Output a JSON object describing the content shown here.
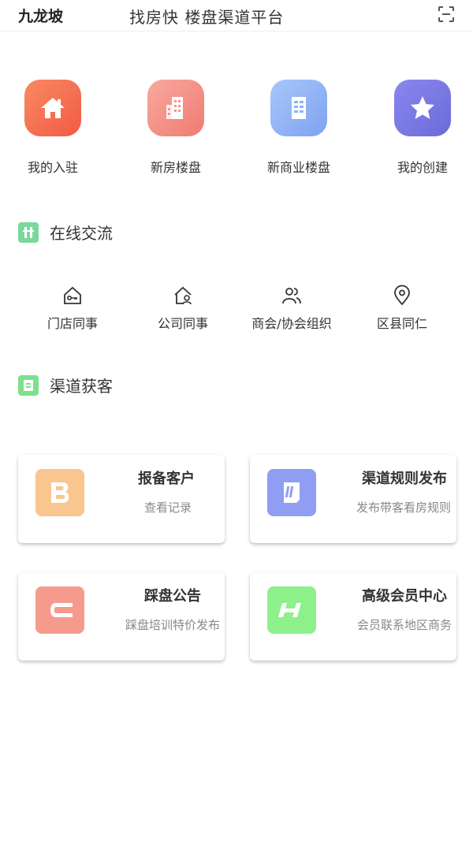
{
  "header": {
    "location": "九龙坡",
    "title": "找房快 楼盘渠道平台",
    "scan_icon": "scan-icon"
  },
  "quick_actions": [
    {
      "label": "我的入驻",
      "icon": "home-icon",
      "color": "#f76f52"
    },
    {
      "label": "新房楼盘",
      "icon": "building-icon",
      "color": "#f5968c"
    },
    {
      "label": "新商业楼盘",
      "icon": "office-icon",
      "color": "#8fb2f7"
    },
    {
      "label": "我的创建",
      "icon": "star-icon",
      "color": "#7b79e6"
    }
  ],
  "online": {
    "title": "在线交流",
    "icon_color": "#7bd89c",
    "items": [
      {
        "label": "门店同事",
        "icon": "store-key-icon"
      },
      {
        "label": "公司同事",
        "icon": "company-person-icon"
      },
      {
        "label": "商会/协会组织",
        "icon": "group-icon"
      },
      {
        "label": "区县同仁",
        "icon": "location-pin-icon"
      }
    ]
  },
  "channel": {
    "title": "渠道获客",
    "icon_color": "#7de08a",
    "cards": [
      {
        "title": "报备客户",
        "subtitle": "查看记录",
        "icon": "letter-b-icon",
        "color": "#f8c68e"
      },
      {
        "title": "渠道规则发布",
        "subtitle": "发布带客看房规则",
        "icon": "document-icon",
        "color": "#8f9ef2"
      },
      {
        "title": "踩盘公告",
        "subtitle": "踩盘培训特价发布",
        "icon": "letter-c-icon",
        "color": "#f59b8e"
      },
      {
        "title": "高级会员中心",
        "subtitle": "会员联系地区商务",
        "icon": "letter-h-icon",
        "color": "#8ef08b"
      }
    ]
  }
}
